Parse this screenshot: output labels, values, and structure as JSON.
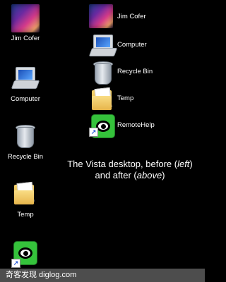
{
  "before": {
    "icons": [
      {
        "label": "Jim Cofer"
      },
      {
        "label": "Computer"
      },
      {
        "label": "Recycle Bin"
      },
      {
        "label": "Temp"
      }
    ],
    "remote_shortcut": "↗"
  },
  "after": {
    "items": [
      {
        "label": "Jim Cofer"
      },
      {
        "label": "Computer"
      },
      {
        "label": "Recycle Bin"
      },
      {
        "label": "Temp"
      },
      {
        "label": "RemoteHelp"
      }
    ],
    "remote_shortcut": "↗"
  },
  "caption": {
    "line1_prefix": "The Vista desktop, before (",
    "line1_em": "left",
    "line1_suffix": ")",
    "line2_prefix": "and after (",
    "line2_em": "above",
    "line2_suffix": ")"
  },
  "watermark": "奇客发现 diglog.com"
}
